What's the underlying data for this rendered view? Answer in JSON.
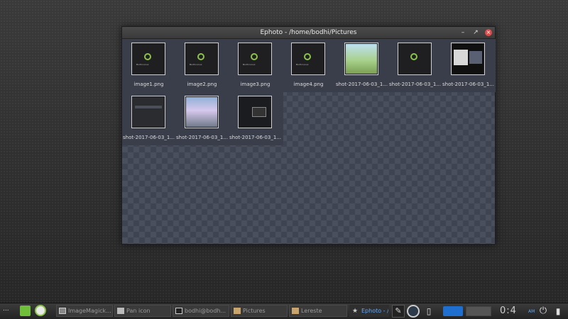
{
  "window": {
    "title": "Ephoto - /home/bodhi/Pictures",
    "minimize_label": "–",
    "maximize_label": "↗",
    "close_label": "×"
  },
  "thumbnails": [
    {
      "caption": "image1.png",
      "logo_text": "Bodhi Linux"
    },
    {
      "caption": "image2.png",
      "logo_text": "Bodhi Linux"
    },
    {
      "caption": "image3.png",
      "logo_text": "Bodhi Linux"
    },
    {
      "caption": "image4.png",
      "logo_text": "Bodhi Linux"
    },
    {
      "caption": "shot-2017-06-03_1..."
    },
    {
      "caption": "shot-2017-06-03_1..."
    },
    {
      "caption": "shot-2017-06-03_1..."
    },
    {
      "caption": "shot-2017-06-03_1..."
    },
    {
      "caption": "shot-2017-06-03_1..."
    },
    {
      "caption": "shot-2017-06-03_1..."
    }
  ],
  "taskbar": {
    "menu_dots": "...",
    "tasks": [
      {
        "label": "ImageMagick...",
        "icon": "image-icon"
      },
      {
        "label": "Pan icon",
        "icon": "pan-icon"
      },
      {
        "label": "bodhi@bodh...",
        "icon": "terminal-icon"
      },
      {
        "label": "Pictures",
        "icon": "folder-icon"
      },
      {
        "label": "Lereste",
        "icon": "folder-icon"
      }
    ],
    "active_task": "Ephoto - /l",
    "clock": "0:4",
    "ampm": "AM"
  },
  "colors": {
    "accent": "#5ea9ff",
    "logo_green": "#8bc34a",
    "close_red": "#e04a4a"
  }
}
